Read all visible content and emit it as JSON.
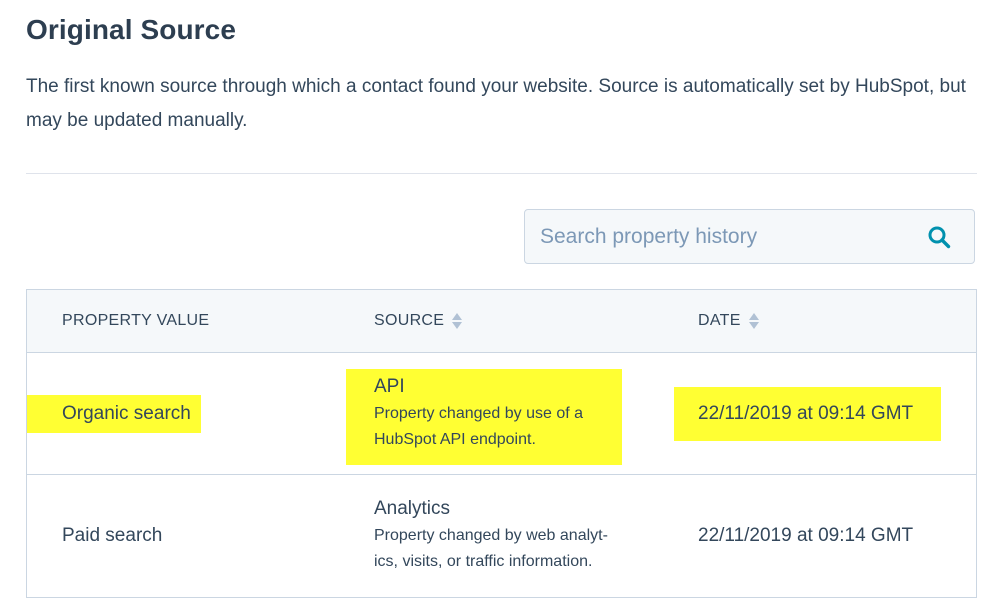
{
  "header": {
    "title": "Original Source",
    "description": "The first known source through which a contact found your website. Source is automatically set by HubSpot, but may be updated manually."
  },
  "search": {
    "placeholder": "Search property history",
    "value": "",
    "icon": "search-icon"
  },
  "table": {
    "columns": [
      {
        "label": "PROPERTY VALUE",
        "sortable": false
      },
      {
        "label": "SOURCE",
        "sortable": true
      },
      {
        "label": "DATE",
        "sortable": true
      }
    ],
    "rows": [
      {
        "value": "Organic search",
        "source": "API",
        "source_description": "Property changed by use of a HubSpot API endpoint.",
        "date": "22/11/2019 at 09:14 GMT",
        "highlighted": true
      },
      {
        "value": "Paid search",
        "source": "Analytics",
        "source_description": "Property changed by web analyt-ics, visits, or traffic information.",
        "date": "22/11/2019 at 09:14 GMT",
        "highlighted": false
      }
    ]
  },
  "colors": {
    "text": "#33475b",
    "title": "#2d3e50",
    "accent": "#0091ae",
    "highlight": "#ffff33",
    "border": "#cbd6e2",
    "header_bg": "#f5f8fa"
  }
}
